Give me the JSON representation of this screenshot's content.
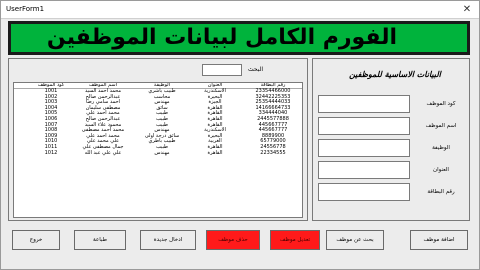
{
  "window": {
    "title": "UserForm1",
    "close_glyph": "✕"
  },
  "header": {
    "title": "الفورم الكامل لبيانات الموظفين",
    "bg_color": "#00b33c"
  },
  "search": {
    "label": "البحث",
    "value": ""
  },
  "table": {
    "columns": [
      "كود الموظف",
      "اسم الموظف",
      "الوظيفة",
      "العنوان",
      "رقم البطاقة"
    ],
    "rows": [
      [
        "1001",
        "محمد احمد السيد",
        "طبيب باشري",
        "الاسكندرية",
        "23354466000"
      ],
      [
        "1002",
        "عبدالرحمن صالح",
        "محاسب",
        "البحيرة",
        "32442225353"
      ],
      [
        "1003",
        "احمد سامي رضا",
        "مهندس",
        "الجيزة",
        "25354444033"
      ],
      [
        "1004",
        "مصطفى سليمان",
        "سائق",
        "القاهرة",
        "14166664733"
      ],
      [
        "1005",
        "محمد احمد علي",
        "طبيب",
        "القاهرة",
        "334444040"
      ],
      [
        "1006",
        "عبدالرحمن صالح",
        "طبيب",
        "القاهرة",
        "2445577888"
      ],
      [
        "1007",
        "محمود علاء السيد",
        "طبيب",
        "القاهرة",
        "445667777"
      ],
      [
        "1008",
        "محمد احمد مصطفى",
        "مهندس",
        "الاسكندرية",
        "445667777"
      ],
      [
        "1009",
        "محمد احمد علي",
        "سائق درجة اولى",
        "البحيرة",
        "8889900"
      ],
      [
        "1010",
        "علي محمد علي",
        "طبيب باطري",
        "الغربية",
        "65779000"
      ],
      [
        "1011",
        "جمال مصطفى علي",
        "طبيب",
        "القاهرة",
        "24556778"
      ],
      [
        "1012",
        "علي علي عبد الله",
        "مهندس",
        "القاهرة",
        "22334555"
      ]
    ]
  },
  "form": {
    "title": "البيانات الاساسية للموظفين",
    "fields": [
      {
        "label": "كود الموظف",
        "value": ""
      },
      {
        "label": "اسم الموظف",
        "value": ""
      },
      {
        "label": "الوظيفة",
        "value": ""
      },
      {
        "label": "العنوان",
        "value": ""
      },
      {
        "label": "رقم البطاقة",
        "value": ""
      }
    ]
  },
  "buttons": {
    "exit": "خروج",
    "print": "طباعة",
    "new_entry": "ادخال جديدة",
    "delete": "حذف موظف",
    "edit": "تعديل موظف",
    "find": "بحث عن موظف",
    "add": "اضافة موظف",
    "danger_color": "#ff1a1a"
  }
}
